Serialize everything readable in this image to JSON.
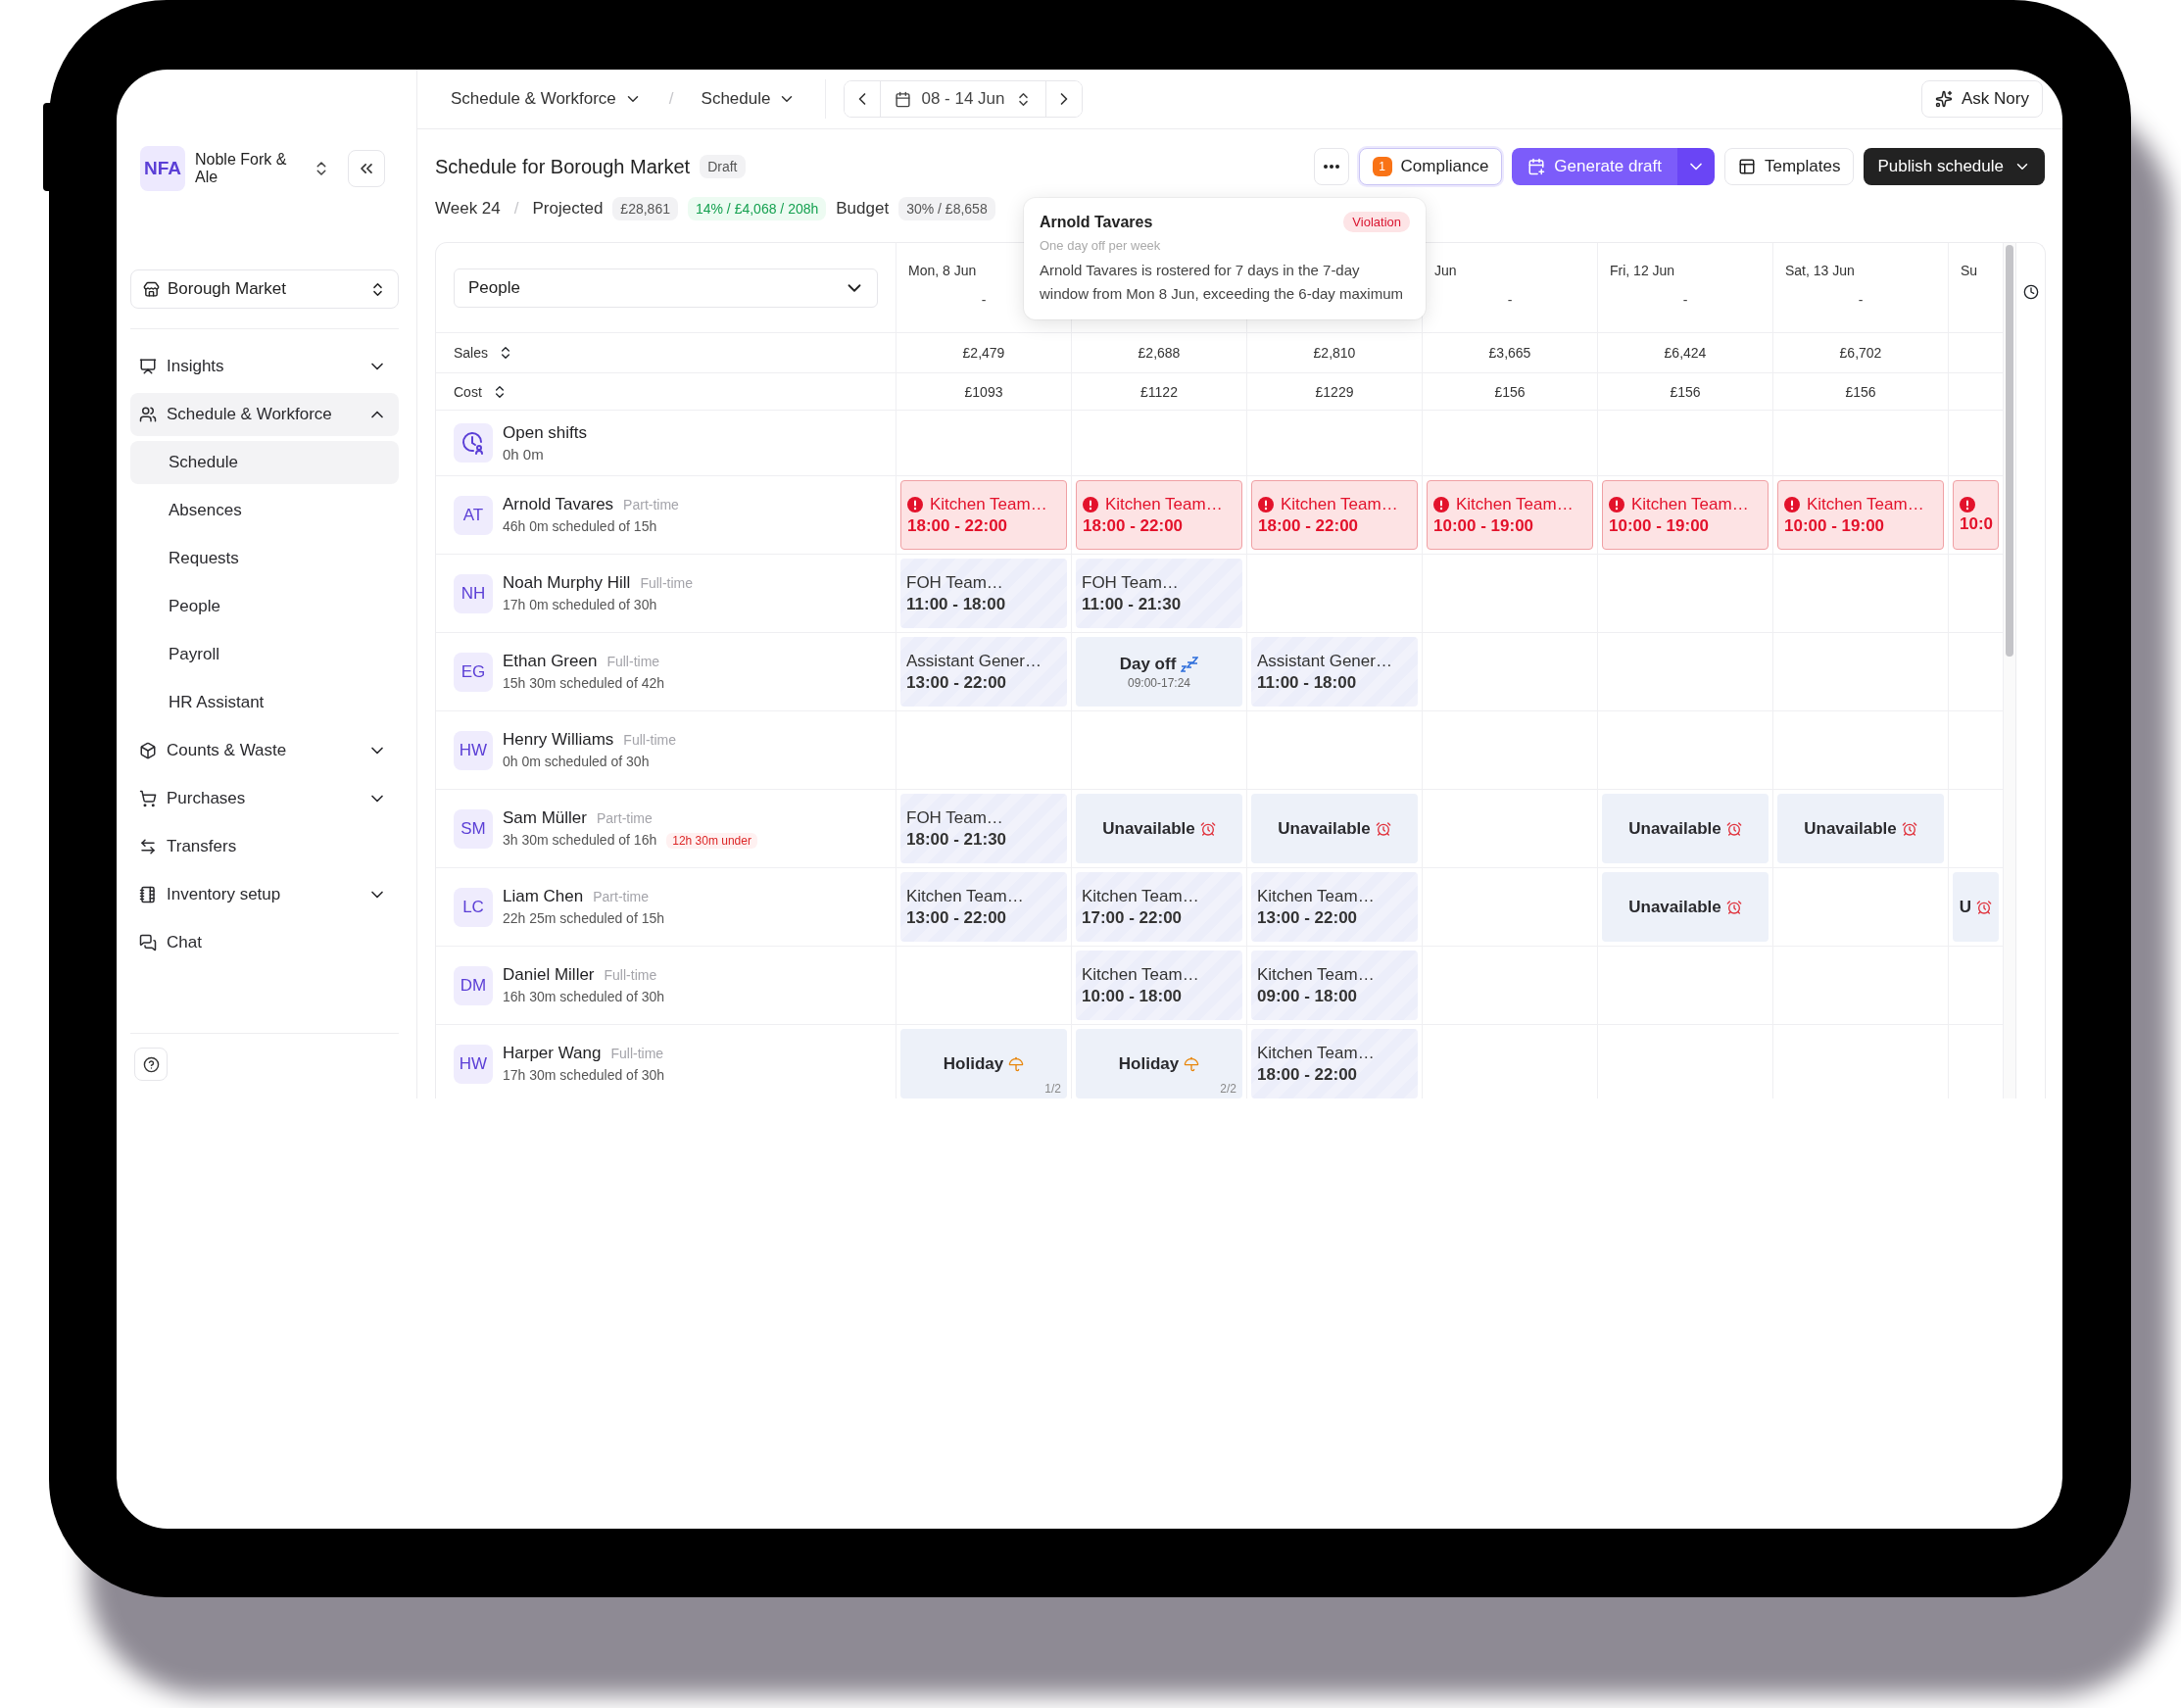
{
  "topbar": {
    "breadcrumbs": [
      {
        "label": "Schedule & Workforce"
      },
      {
        "label": "Schedule"
      }
    ],
    "separator": "/",
    "date_range": "08 - 14 Jun",
    "ask_button": "Ask Nory"
  },
  "org": {
    "initials": "NFA",
    "name": "Noble Fork & Ale"
  },
  "location": "Borough Market",
  "nav": [
    {
      "label": "Insights",
      "expanded": false,
      "selected": false
    },
    {
      "label": "Schedule & Workforce",
      "expanded": true,
      "selected": true,
      "children": [
        {
          "label": "Schedule",
          "selected": true
        },
        {
          "label": "Absences",
          "selected": false
        },
        {
          "label": "Requests",
          "selected": false
        },
        {
          "label": "People",
          "selected": false
        },
        {
          "label": "Payroll",
          "selected": false
        },
        {
          "label": "HR Assistant",
          "selected": false
        }
      ]
    },
    {
      "label": "Counts & Waste",
      "expanded": false,
      "selected": false
    },
    {
      "label": "Purchases",
      "expanded": false,
      "selected": false
    },
    {
      "label": "Transfers",
      "selected": false
    },
    {
      "label": "Inventory setup",
      "expanded": false,
      "selected": false
    },
    {
      "label": "Chat",
      "selected": false
    }
  ],
  "header": {
    "title": "Schedule for Borough Market",
    "status": "Draft",
    "week": "Week 24",
    "separator": "/",
    "projected_label": "Projected",
    "projected": "£28,861",
    "labour": "14% / £4,068 / 208h",
    "budget_label": "Budget",
    "budget": "30% / £8,658"
  },
  "actions": {
    "compliance": {
      "label": "Compliance",
      "count": "1"
    },
    "generate": "Generate draft",
    "templates": "Templates",
    "publish": "Publish schedule"
  },
  "tooltip": {
    "name": "Arnold Tavares",
    "badge": "Violation",
    "rule": "One day off per week",
    "text": "Arnold Tavares is rostered for 7 days in the 7-day window from Mon 8 Jun, exceeding the 6-day maximum"
  },
  "grid": {
    "group_select": "People",
    "days": [
      {
        "kind": "date",
        "label": "Mon, 8 Jun",
        "sub": "-"
      },
      {
        "kind": "covered"
      },
      {
        "kind": "covered"
      },
      {
        "kind": "date",
        "label": "Jun",
        "sub": "-"
      },
      {
        "kind": "date",
        "label": "Fri, 12 Jun",
        "sub": "-"
      },
      {
        "kind": "date",
        "label": "Sat, 13 Jun",
        "sub": "-"
      },
      {
        "kind": "date",
        "label": "Su"
      }
    ],
    "sales_label": "Sales",
    "sales": [
      "£2,479",
      "£2,688",
      "£2,810",
      "£3,665",
      "£6,424",
      "£6,702"
    ],
    "cost_label": "Cost",
    "cost": [
      "£1093",
      "£1122",
      "£1229",
      "£156",
      "£156",
      "£156"
    ],
    "open_shifts": {
      "label": "Open shifts",
      "hours": "0h 0m"
    },
    "people": [
      {
        "initials": "AT",
        "name": "Arnold Tavares",
        "contract": "Part-time",
        "scheduled": "46h 0m scheduled of 15h",
        "shifts": [
          {
            "kind": "violation",
            "title": "Kitchen Team…",
            "time": "18:00 - 22:00"
          },
          {
            "kind": "violation",
            "title": "Kitchen Team…",
            "time": "18:00 - 22:00"
          },
          {
            "kind": "violation",
            "title": "Kitchen Team…",
            "time": "18:00 - 22:00"
          },
          {
            "kind": "violation",
            "title": "Kitchen Team…",
            "time": "10:00 - 19:00"
          },
          {
            "kind": "violation",
            "title": "Kitchen Team…",
            "time": "10:00 - 19:00"
          },
          {
            "kind": "violation",
            "title": "Kitchen Team…",
            "time": "10:00 - 19:00"
          },
          {
            "kind": "violation",
            "time": "10:0"
          }
        ]
      },
      {
        "initials": "NH",
        "name": "Noah Murphy Hill",
        "contract": "Full-time",
        "scheduled": "17h 0m scheduled of 30h",
        "shifts": [
          {
            "kind": "shift",
            "title": "FOH Team…",
            "time": "11:00 - 18:00"
          },
          {
            "kind": "shift",
            "title": "FOH Team…",
            "time": "11:00 - 21:30"
          },
          {
            "kind": "empty"
          },
          {
            "kind": "empty"
          },
          {
            "kind": "empty"
          },
          {
            "kind": "empty"
          },
          {
            "kind": "empty"
          }
        ]
      },
      {
        "initials": "EG",
        "name": "Ethan Green",
        "contract": "Full-time",
        "scheduled": "15h 30m scheduled of 42h",
        "shifts": [
          {
            "kind": "shift",
            "title": "Assistant Gener…",
            "time": "13:00 - 22:00"
          },
          {
            "kind": "day_off",
            "label": "Day off",
            "detail": "09:00-17:24"
          },
          {
            "kind": "shift",
            "title": "Assistant Gener…",
            "time": "11:00 - 18:00"
          },
          {
            "kind": "empty"
          },
          {
            "kind": "empty"
          },
          {
            "kind": "empty"
          },
          {
            "kind": "empty"
          }
        ]
      },
      {
        "initials": "HW",
        "name": "Henry Williams",
        "contract": "Full-time",
        "scheduled": "0h 0m scheduled of 30h",
        "shifts": [
          {
            "kind": "empty"
          },
          {
            "kind": "empty"
          },
          {
            "kind": "empty"
          },
          {
            "kind": "empty"
          },
          {
            "kind": "empty"
          },
          {
            "kind": "empty"
          },
          {
            "kind": "empty"
          }
        ]
      },
      {
        "initials": "SM",
        "name": "Sam Müller",
        "contract": "Part-time",
        "scheduled": "3h 30m scheduled of 16h",
        "warning": "12h 30m under",
        "shifts": [
          {
            "kind": "shift",
            "title": "FOH Team…",
            "time": "18:00 - 21:30"
          },
          {
            "kind": "unavailable",
            "label": "Unavailable"
          },
          {
            "kind": "unavailable",
            "label": "Unavailable"
          },
          {
            "kind": "empty"
          },
          {
            "kind": "unavailable",
            "label": "Unavailable"
          },
          {
            "kind": "unavailable",
            "label": "Unavailable"
          },
          {
            "kind": "empty"
          }
        ]
      },
      {
        "initials": "LC",
        "name": "Liam Chen",
        "contract": "Part-time",
        "scheduled": "22h 25m scheduled of 15h",
        "shifts": [
          {
            "kind": "shift",
            "title": "Kitchen Team…",
            "time": "13:00 - 22:00"
          },
          {
            "kind": "shift",
            "title": "Kitchen Team…",
            "time": "17:00 - 22:00"
          },
          {
            "kind": "shift",
            "title": "Kitchen Team…",
            "time": "13:00 - 22:00"
          },
          {
            "kind": "empty"
          },
          {
            "kind": "unavailable",
            "label": "Unavailable"
          },
          {
            "kind": "empty"
          },
          {
            "kind": "unavailable",
            "label": "U"
          }
        ]
      },
      {
        "initials": "DM",
        "name": "Daniel Miller",
        "contract": "Full-time",
        "scheduled": "16h 30m scheduled of 30h",
        "shifts": [
          {
            "kind": "empty"
          },
          {
            "kind": "shift",
            "title": "Kitchen Team…",
            "time": "10:00 - 18:00"
          },
          {
            "kind": "shift",
            "title": "Kitchen Team…",
            "time": "09:00 - 18:00"
          },
          {
            "kind": "empty"
          },
          {
            "kind": "empty"
          },
          {
            "kind": "empty"
          },
          {
            "kind": "empty"
          }
        ]
      },
      {
        "initials": "HW",
        "name": "Harper Wang",
        "contract": "Full-time",
        "scheduled": "17h 30m scheduled of 30h",
        "shifts": [
          {
            "kind": "holiday",
            "label": "Holiday",
            "page": "1/2"
          },
          {
            "kind": "holiday",
            "label": "Holiday",
            "page": "2/2"
          },
          {
            "kind": "shift",
            "title": "Kitchen Team…",
            "time": "18:00 - 22:00"
          },
          {
            "kind": "empty"
          },
          {
            "kind": "empty"
          },
          {
            "kind": "empty"
          },
          {
            "kind": "empty"
          }
        ]
      }
    ]
  }
}
